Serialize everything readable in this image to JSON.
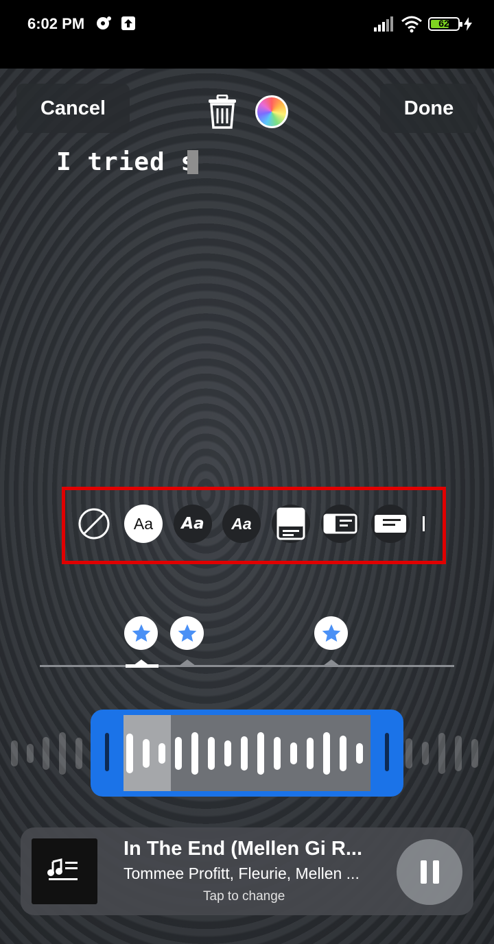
{
  "status_bar": {
    "time": "6:02 PM",
    "battery_level": "62",
    "icons": [
      "notification-icon",
      "upload-icon",
      "signal-icon",
      "wifi-icon",
      "battery-icon",
      "charging-icon"
    ]
  },
  "editor": {
    "cancel_label": "Cancel",
    "done_label": "Done",
    "caption_text": "I tried s",
    "icons": [
      "trash-icon",
      "color-wheel-icon"
    ]
  },
  "text_styles": {
    "options": [
      {
        "name": "none",
        "label": ""
      },
      {
        "name": "classic",
        "label": "Aa",
        "selected": true
      },
      {
        "name": "bold-italic",
        "label": "Aa"
      },
      {
        "name": "italic",
        "label": "Aa"
      },
      {
        "name": "card",
        "label": ""
      },
      {
        "name": "lyrics-left",
        "label": ""
      },
      {
        "name": "lyrics-right",
        "label": ""
      }
    ],
    "highlight_color": "#e00000"
  },
  "timeline": {
    "markers": [
      "star-icon",
      "star-icon",
      "star-icon"
    ],
    "accent": "#4a90f5"
  },
  "scrubber": {
    "color": "#1b73e8"
  },
  "music": {
    "title": "In The End (Mellen Gi R...",
    "artist": "Tommee Profitt, Fleurie, Mellen ...",
    "hint": "Tap to change"
  }
}
